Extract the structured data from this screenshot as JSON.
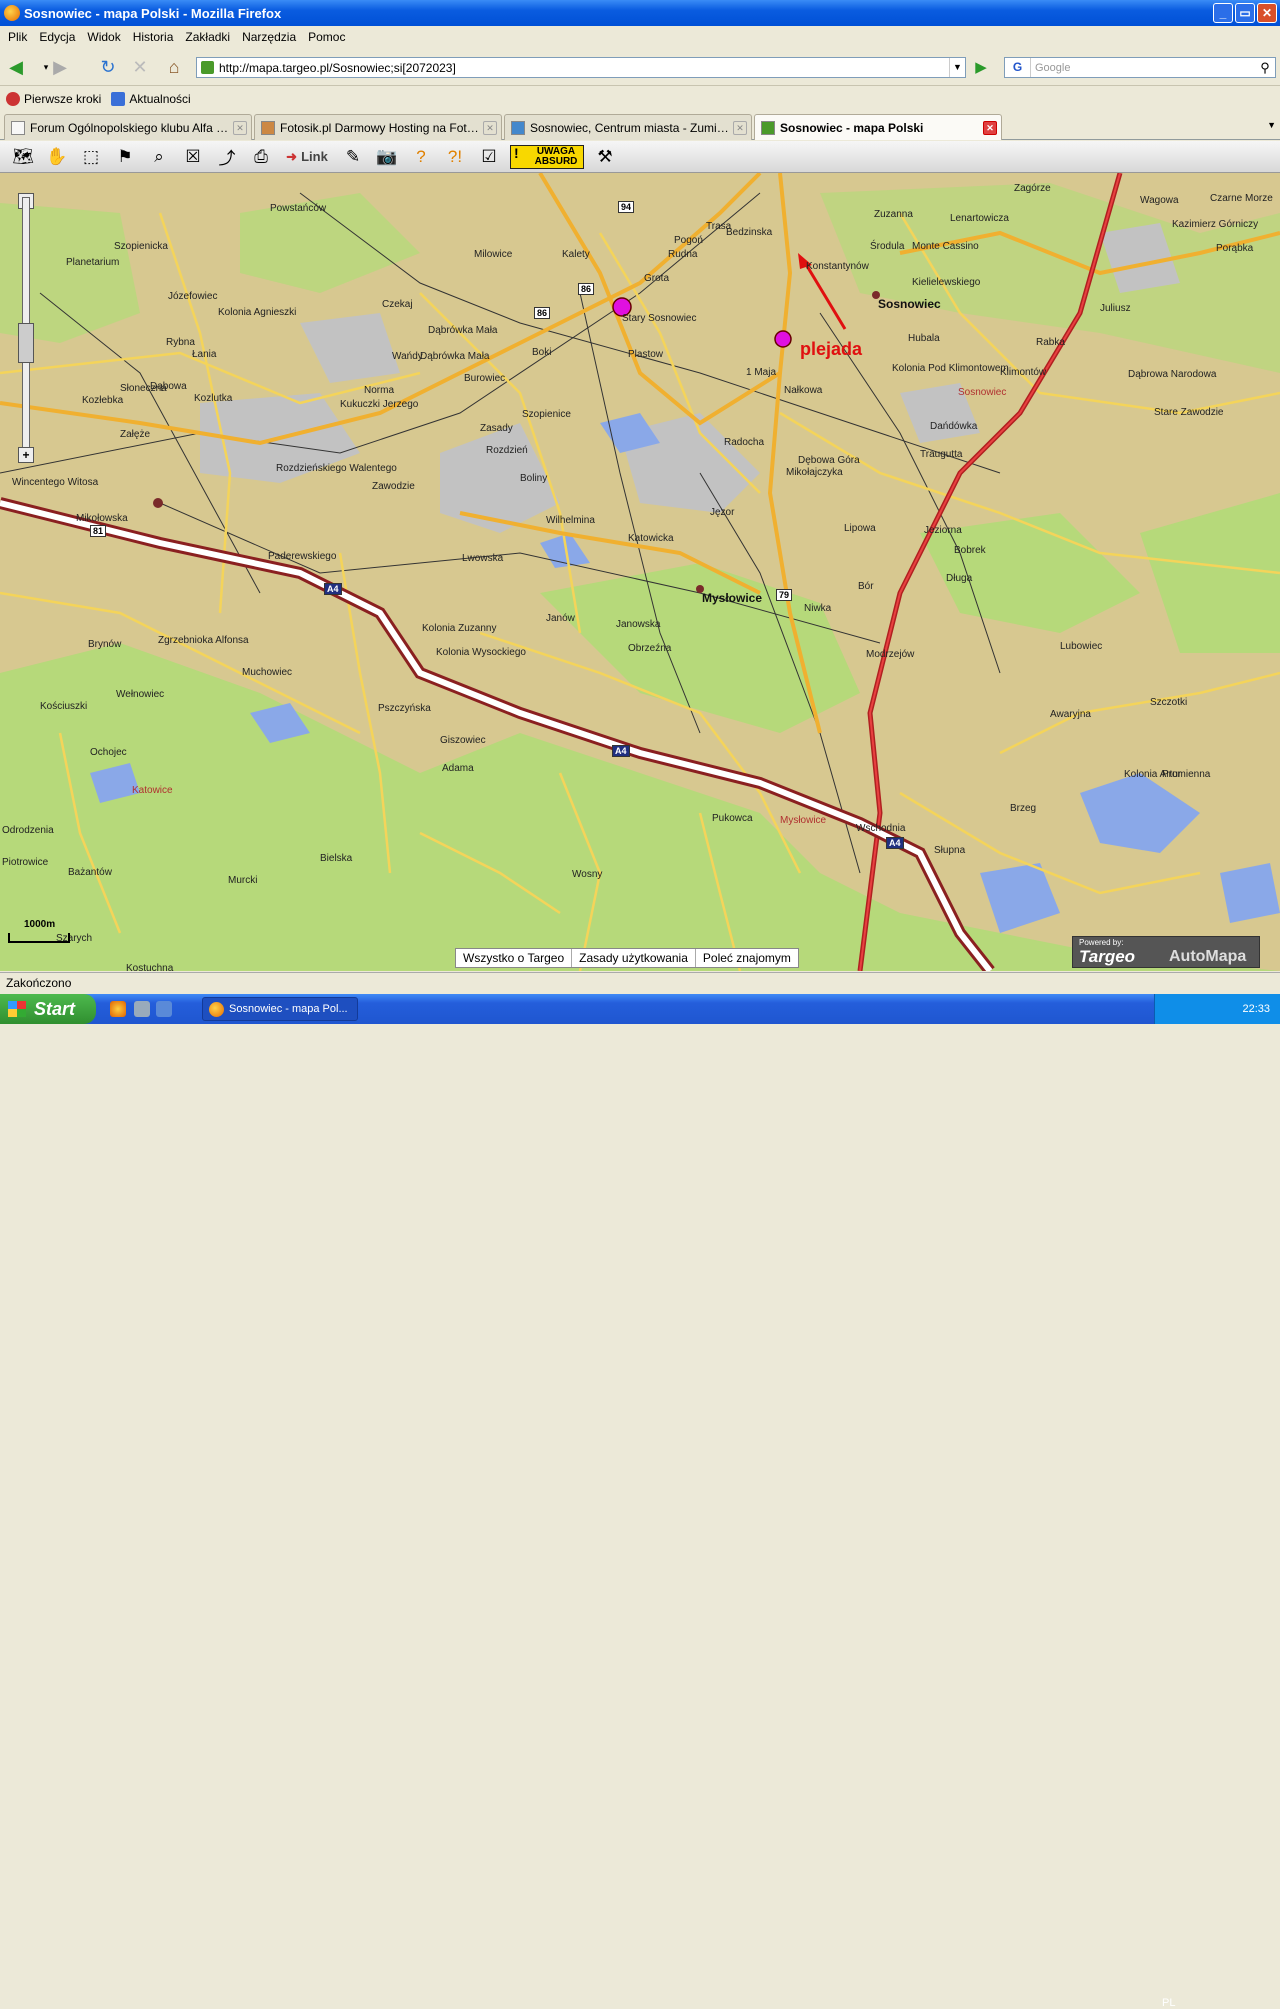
{
  "window": {
    "title": "Sosnowiec - mapa Polski - Mozilla Firefox"
  },
  "menu": [
    "Plik",
    "Edycja",
    "Widok",
    "Historia",
    "Zakładki",
    "Narzędzia",
    "Pomoc"
  ],
  "nav": {
    "url": "http://mapa.targeo.pl/Sosnowiec;si[2072023]",
    "search_placeholder": "Google"
  },
  "bookmarks": [
    "Pierwsze kroki",
    "Aktualności"
  ],
  "tabs": [
    {
      "label": "Forum Ogólnopolskiego klubu Alfa Ro..."
    },
    {
      "label": "Fotosik.pl Darmowy Hosting na Fotki Z..."
    },
    {
      "label": "Sosnowiec, Centrum miasta - Zumi.pl L..."
    },
    {
      "label": "Sosnowiec - mapa Polski"
    }
  ],
  "toolbar": {
    "link_label": "Link",
    "absurd_label": "UWAGA ABSURD",
    "icons": [
      "map-icon",
      "hand-icon",
      "select-icon",
      "route-icon",
      "binoculars-icon",
      "checkbox-icon",
      "measure-icon",
      "print-icon",
      "link-icon",
      "edit-icon",
      "camera-icon",
      "help-icon",
      "help-alert-icon",
      "absurd-icon",
      "pin-icon"
    ]
  },
  "map": {
    "annotation": "plejada",
    "labels": [
      {
        "t": "Sosnowiec",
        "c": "big"
      },
      {
        "t": "Mysłowice",
        "c": "big"
      },
      {
        "t": "Katowice",
        "c": "red"
      },
      {
        "t": "Sosnowiec",
        "c": "red"
      },
      {
        "t": "Mysłowice",
        "c": "red"
      },
      {
        "t": "Powstańców"
      },
      {
        "t": "Milowice"
      },
      {
        "t": "Kalety"
      },
      {
        "t": "Pogoń"
      },
      {
        "t": "Rudna"
      },
      {
        "t": "Grota"
      },
      {
        "t": "Stary Sosnowiec"
      },
      {
        "t": "Zagórze"
      },
      {
        "t": "Zuzanna"
      },
      {
        "t": "Środula"
      },
      {
        "t": "Monte Cassino"
      },
      {
        "t": "Kielielewskiego"
      },
      {
        "t": "Lenartowicza"
      },
      {
        "t": "Konstantynów"
      },
      {
        "t": "Hubala"
      },
      {
        "t": "Rabka"
      },
      {
        "t": "Kolonia Pod Klimontowem"
      },
      {
        "t": "Klimontów"
      },
      {
        "t": "1 Maja"
      },
      {
        "t": "Plastow"
      },
      {
        "t": "Boki"
      },
      {
        "t": "Czekaj"
      },
      {
        "t": "Dąbrówka Mała"
      },
      {
        "t": "Burowiec"
      },
      {
        "t": "Szopienice"
      },
      {
        "t": "Radocha"
      },
      {
        "t": "Dębowa Góra"
      },
      {
        "t": "Mikołajczyka"
      },
      {
        "t": "Dańdówka"
      },
      {
        "t": "Traugutta"
      },
      {
        "t": "Kostuchna"
      },
      {
        "t": "Murcki"
      },
      {
        "t": "Janów"
      },
      {
        "t": "Wilhelmina"
      },
      {
        "t": "Katowicka"
      },
      {
        "t": "Janowska"
      },
      {
        "t": "Obrzeźna"
      },
      {
        "t": "Kolonia Zuzanny"
      },
      {
        "t": "Kolonia Wysockiego"
      },
      {
        "t": "Paderewskiego"
      },
      {
        "t": "Muchowiec"
      },
      {
        "t": "Brynów"
      },
      {
        "t": "Zgrzebnioka Alfonsa"
      },
      {
        "t": "Mikołowska"
      },
      {
        "t": "Kościuszki"
      },
      {
        "t": "Ochojec"
      },
      {
        "t": "Piotrowice"
      },
      {
        "t": "Szarych"
      },
      {
        "t": "Bażantów"
      },
      {
        "t": "Odrodzenia"
      },
      {
        "t": "Giszowiec"
      },
      {
        "t": "Adama"
      },
      {
        "t": "Pszczyńska"
      },
      {
        "t": "Bielska"
      },
      {
        "t": "Wosny"
      },
      {
        "t": "Pukowca"
      },
      {
        "t": "Wschodnia"
      },
      {
        "t": "Słupna"
      },
      {
        "t": "Brzeg"
      },
      {
        "t": "Promienna"
      },
      {
        "t": "Kolonia Artur"
      },
      {
        "t": "Awaryjna"
      },
      {
        "t": "Lubowiec"
      },
      {
        "t": "Szczotki"
      },
      {
        "t": "Dąbrowa Narodowa"
      },
      {
        "t": "Stare Zawodzie"
      },
      {
        "t": "Juliusz"
      },
      {
        "t": "Porąbka"
      },
      {
        "t": "Wagowa"
      },
      {
        "t": "Czarne Morze"
      },
      {
        "t": "Kazimierz Górniczy"
      },
      {
        "t": "Jeziorna"
      },
      {
        "t": "Bobrek"
      },
      {
        "t": "Długa"
      },
      {
        "t": "Bór"
      },
      {
        "t": "Niwka"
      },
      {
        "t": "Modrzejów"
      },
      {
        "t": "Jęzor"
      },
      {
        "t": "Boliny"
      },
      {
        "t": "Lwowska"
      },
      {
        "t": "Szopienicka"
      },
      {
        "t": "Planetarium"
      },
      {
        "t": "Łania"
      },
      {
        "t": "Słoneczna"
      },
      {
        "t": "Dąbowa"
      },
      {
        "t": "Kozlutka"
      },
      {
        "t": "Załęże"
      },
      {
        "t": "Wincentego Witosa"
      },
      {
        "t": "Rozdzieńskiego Walentego"
      },
      {
        "t": "Kukuczki Jerzego"
      },
      {
        "t": "Zawodzie"
      },
      {
        "t": "Rozdzień"
      },
      {
        "t": "Norma"
      },
      {
        "t": "Dąbrówka Mała"
      },
      {
        "t": "Wańdy"
      },
      {
        "t": "Nałkowa"
      },
      {
        "t": "Lipowa"
      },
      {
        "t": "Kozłebka"
      },
      {
        "t": "Trasa"
      },
      {
        "t": "Bedzinska"
      },
      {
        "t": "Rybna"
      },
      {
        "t": "Józefowiec"
      },
      {
        "t": "Kolonia Agnieszki"
      },
      {
        "t": "Wełnowiec"
      },
      {
        "t": "Ochojec"
      },
      {
        "t": "Zasady"
      }
    ],
    "roads": [
      "94",
      "86",
      "86",
      "81",
      "79",
      "A4",
      "A4",
      "A4"
    ],
    "scale": "1000m",
    "links": [
      "Wszystko o Targeo",
      "Zasady użytkowania",
      "Poleć znajomym"
    ],
    "powered": {
      "by": "Powered by:",
      "brand1": "Targeo",
      "brand2": "AutoMapa"
    }
  },
  "status": "Zakończono",
  "taskbar": {
    "start": "Start",
    "item": "Sosnowiec - mapa Pol...",
    "lang": "PL",
    "time": "22:33"
  }
}
